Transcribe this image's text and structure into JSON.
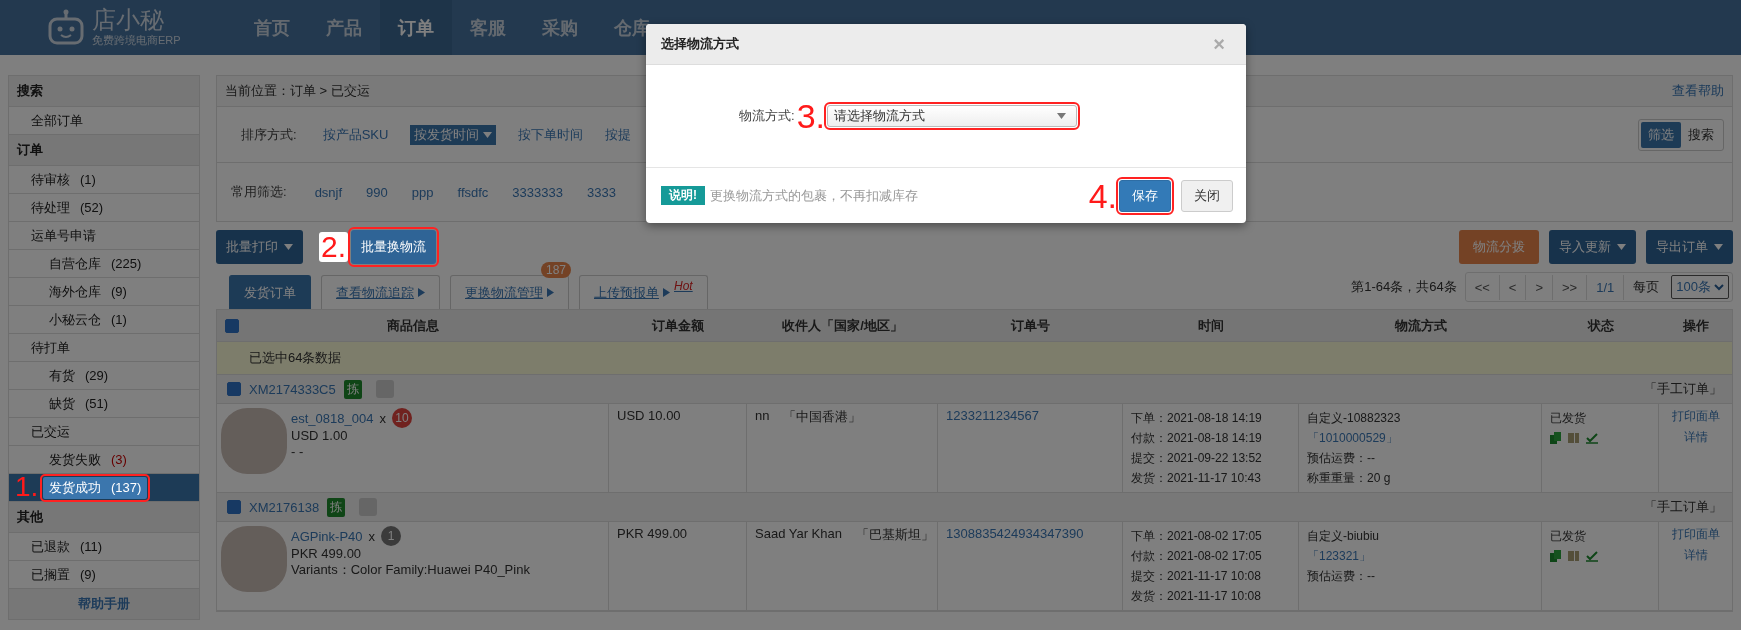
{
  "nav": {
    "logo": "店小秘",
    "tagline": "免费跨境电商ERP",
    "items": [
      {
        "label": "首页",
        "selected": false
      },
      {
        "label": "产品",
        "selected": false
      },
      {
        "label": "订单",
        "selected": true
      },
      {
        "label": "客服",
        "selected": false
      },
      {
        "label": "采购",
        "selected": false
      },
      {
        "label": "仓库",
        "selected": false
      }
    ]
  },
  "sidebar": {
    "sections": [
      {
        "title": "搜索",
        "items": [
          {
            "label": "全部订单",
            "selected": false
          }
        ]
      },
      {
        "title": "订单",
        "items": [
          {
            "label": "待审核",
            "count": "(1)",
            "alert": false,
            "selected": false
          },
          {
            "label": "待处理",
            "count": "(52)",
            "alert": false,
            "selected": false
          },
          {
            "label": "运单号申请",
            "selected": false,
            "children": [
              {
                "label": "自营仓库",
                "count": "(225)",
                "alert": false,
                "selected": false
              },
              {
                "label": "海外仓库",
                "count": "(9)",
                "alert": false,
                "selected": false
              },
              {
                "label": "小秘云仓",
                "count": "(1)",
                "alert": false,
                "selected": false
              }
            ]
          },
          {
            "label": "待打单",
            "selected": false,
            "children": [
              {
                "label": "有货",
                "count": "(29)",
                "alert": false,
                "selected": false
              },
              {
                "label": "缺货",
                "count": "(51)",
                "alert": false,
                "selected": false
              }
            ]
          },
          {
            "label": "已交运",
            "selected": false,
            "children": [
              {
                "label": "发货失败",
                "count": "(3)",
                "alert": true,
                "selected": false
              },
              {
                "label": "发货成功",
                "count": "(137)",
                "alert": false,
                "selected": true,
                "step": "1."
              }
            ]
          }
        ]
      },
      {
        "title": "其他",
        "items": [
          {
            "label": "已退款",
            "count": "(11)",
            "alert": false,
            "selected": false
          },
          {
            "label": "已搁置",
            "count": "(9)",
            "alert": false,
            "selected": false
          }
        ]
      }
    ],
    "footer": "帮助手册"
  },
  "breadcrumb": {
    "label": "当前位置：",
    "path": "订单 > 已交运",
    "help": "查看帮助"
  },
  "sort": {
    "label": "排序方式:",
    "options": [
      {
        "label": "按产品SKU",
        "selected": false
      },
      {
        "label": "按发货时间",
        "selected": true
      },
      {
        "label": "按下单时间",
        "selected": false
      },
      {
        "label": "按提",
        "selected": false
      }
    ]
  },
  "filters": {
    "label": "常用筛选:",
    "items": [
      "dsnjf",
      "990",
      "ppp",
      "ffsdfc",
      "3333333",
      "3333"
    ]
  },
  "view_toggle": [
    {
      "label": "筛选",
      "selected": true
    },
    {
      "label": "搜索",
      "selected": false
    }
  ],
  "toolbar": {
    "left": [
      {
        "label": "批量打印",
        "kind": "dropdown"
      },
      {
        "label": "批量换物流",
        "kind": "plain",
        "step": "2."
      }
    ],
    "right": [
      {
        "label": "物流分拨",
        "kind": "warning"
      },
      {
        "label": "导入更新",
        "kind": "dropdown"
      },
      {
        "label": "导出订单",
        "kind": "dropdown"
      }
    ]
  },
  "tabs": [
    {
      "label": "发货订单",
      "selected": true
    },
    {
      "label": "查看物流追踪",
      "selected": false
    },
    {
      "label": "更换物流管理",
      "selected": false,
      "badge": "187"
    },
    {
      "label": "上传预报单",
      "selected": false,
      "hot": "Hot"
    }
  ],
  "pagination": {
    "summary": "第1-64条，共64条",
    "buttons": [
      "<<",
      "<",
      ">",
      ">>"
    ],
    "page": "1/1",
    "per_page_label": "每页",
    "per_page": "100条"
  },
  "table": {
    "select_all": {
      "checked": true
    },
    "columns": [
      "商品信息",
      "订单金额",
      "收件人「国家/地区」",
      "订单号",
      "时间",
      "物流方式",
      "状态",
      "操作"
    ],
    "selection_note": "已选中64条数据",
    "orders": [
      {
        "checked": true,
        "id": "XM2174333C5",
        "tag": "拣",
        "source": "「手工订单」",
        "product": "est_0818_004",
        "times_sign": "x",
        "qty": {
          "text": "10",
          "highlight": true
        },
        "price": "USD 1.00",
        "variant": "- -",
        "amount": "USD 10.00",
        "recipient": "nn",
        "country": "「中国香港」",
        "order_no": "1233211234567",
        "times": [
          "下单：2021-08-18 14:19",
          "付款：2021-08-18 14:19",
          "提交：2021-09-22 13:52",
          "发货：2021-11-17 10:43"
        ],
        "logistics": "自定义-10882323",
        "tracking": "「1010000529」",
        "logistics_notes": [
          "预估运费：--",
          "称重重量：20 g"
        ],
        "status": "已发货",
        "actions": [
          "打印面单",
          "详情"
        ]
      },
      {
        "checked": true,
        "id": "XM2176138",
        "tag": "拣",
        "source": "「手工订单」",
        "product": "AGPink-P40",
        "times_sign": "x",
        "qty": {
          "text": "1",
          "highlight": false
        },
        "price": "PKR 499.00",
        "variant": "Variants：Color Family:Huawei P40_Pink",
        "amount": "PKR 499.00",
        "recipient": "Saad Yar Khan",
        "country": "「巴基斯坦」",
        "order_no": "1308835424934347390",
        "times": [
          "下单：2021-08-02 17:05",
          "付款：2021-08-02 17:05",
          "提交：2021-11-17 10:08",
          "发货：2021-11-17 10:08"
        ],
        "logistics": "自定义-biubiu",
        "tracking": "「123321」",
        "logistics_notes": [
          "预估运费：--"
        ],
        "status": "已发货",
        "actions": [
          "打印面单",
          "详情"
        ]
      }
    ]
  },
  "modal": {
    "title": "选择物流方式",
    "close": "×",
    "field_label": "物流方式:",
    "field_step": "3.",
    "select_placeholder": "请选择物流方式",
    "note_badge": "说明!",
    "note": "更换物流方式的包裹，不再扣减库存",
    "buttons": [
      {
        "label": "保存",
        "kind": "primary",
        "step": "4."
      },
      {
        "label": "关闭",
        "kind": "default"
      }
    ]
  }
}
